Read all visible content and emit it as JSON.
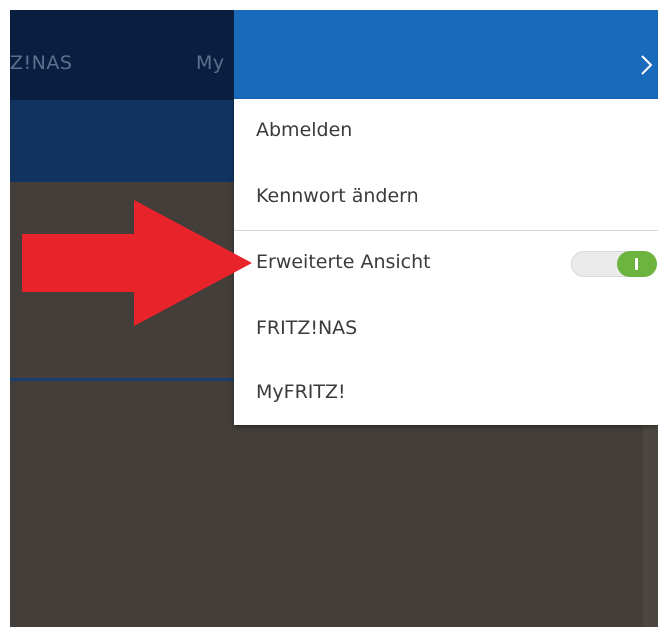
{
  "background": {
    "nav_items": [
      {
        "label": "Z!NAS"
      },
      {
        "label": "My"
      }
    ]
  },
  "menu": {
    "items": [
      {
        "label": "Abmelden"
      },
      {
        "label": "Kennwort ändern"
      },
      {
        "label": "Erweiterte Ansicht",
        "toggle_on": true
      },
      {
        "label": "FRITZ!NAS"
      },
      {
        "label": "MyFRITZ!"
      }
    ]
  },
  "annotation": {
    "arrow_color": "#e8232a"
  },
  "colors": {
    "menu_header": "#1a6abb",
    "toggle_on": "#6cb33f",
    "nav_dark": "#0a1f40",
    "content_bg": "#433e39"
  }
}
